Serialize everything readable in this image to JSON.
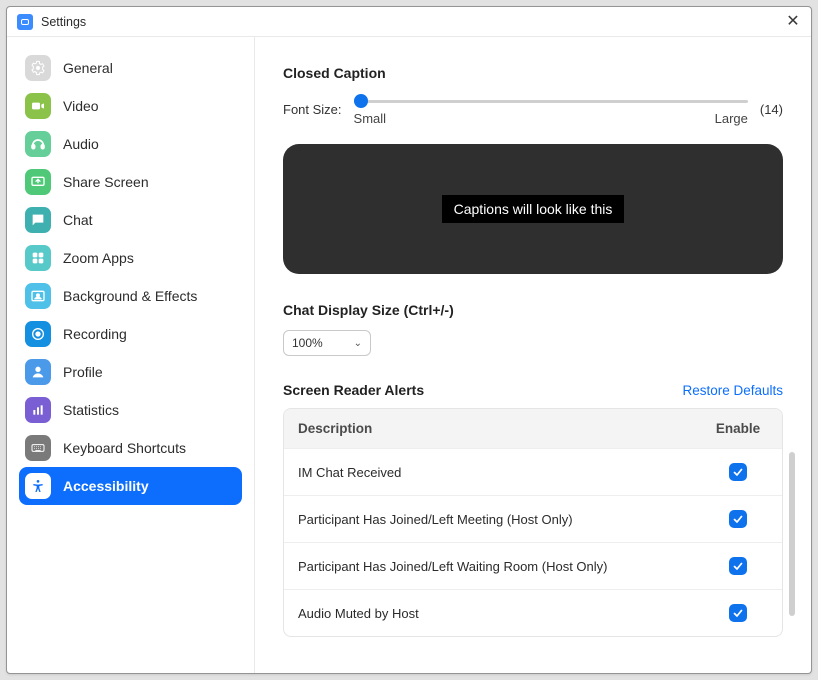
{
  "window": {
    "title": "Settings"
  },
  "sidebar": {
    "items": [
      {
        "label": "General",
        "key": "general"
      },
      {
        "label": "Video",
        "key": "video"
      },
      {
        "label": "Audio",
        "key": "audio"
      },
      {
        "label": "Share Screen",
        "key": "share-screen"
      },
      {
        "label": "Chat",
        "key": "chat"
      },
      {
        "label": "Zoom Apps",
        "key": "zoom-apps"
      },
      {
        "label": "Background & Effects",
        "key": "background"
      },
      {
        "label": "Recording",
        "key": "recording"
      },
      {
        "label": "Profile",
        "key": "profile"
      },
      {
        "label": "Statistics",
        "key": "statistics"
      },
      {
        "label": "Keyboard Shortcuts",
        "key": "keyboard"
      },
      {
        "label": "Accessibility",
        "key": "accessibility"
      }
    ],
    "activeIndex": 11
  },
  "closedCaption": {
    "title": "Closed Caption",
    "fontSizeLabel": "Font Size:",
    "smallLabel": "Small",
    "largeLabel": "Large",
    "fontSizeValue": "(14)",
    "preview": "Captions will look like this"
  },
  "chatDisplay": {
    "title": "Chat Display Size (Ctrl+/-)",
    "value": "100%"
  },
  "screenReader": {
    "title": "Screen Reader Alerts",
    "restore": "Restore Defaults",
    "columns": {
      "desc": "Description",
      "enable": "Enable"
    },
    "rows": [
      {
        "desc": "IM Chat Received",
        "enabled": true
      },
      {
        "desc": "Participant Has Joined/Left Meeting (Host Only)",
        "enabled": true
      },
      {
        "desc": "Participant Has Joined/Left Waiting Room (Host Only)",
        "enabled": true
      },
      {
        "desc": "Audio Muted by Host",
        "enabled": true
      }
    ]
  },
  "iconColors": {
    "general": "#d9d9d9",
    "video": "#8bc34a",
    "audio": "#66cf99",
    "share-screen": "#4fc978",
    "chat": "#3fb0b0",
    "zoom-apps": "#58c9c9",
    "background": "#4fc0e8",
    "recording": "#1590e0",
    "profile": "#4b9aea",
    "statistics": "#7a5ed4",
    "keyboard": "#7a7a7a",
    "accessibility": "#ffffff"
  }
}
